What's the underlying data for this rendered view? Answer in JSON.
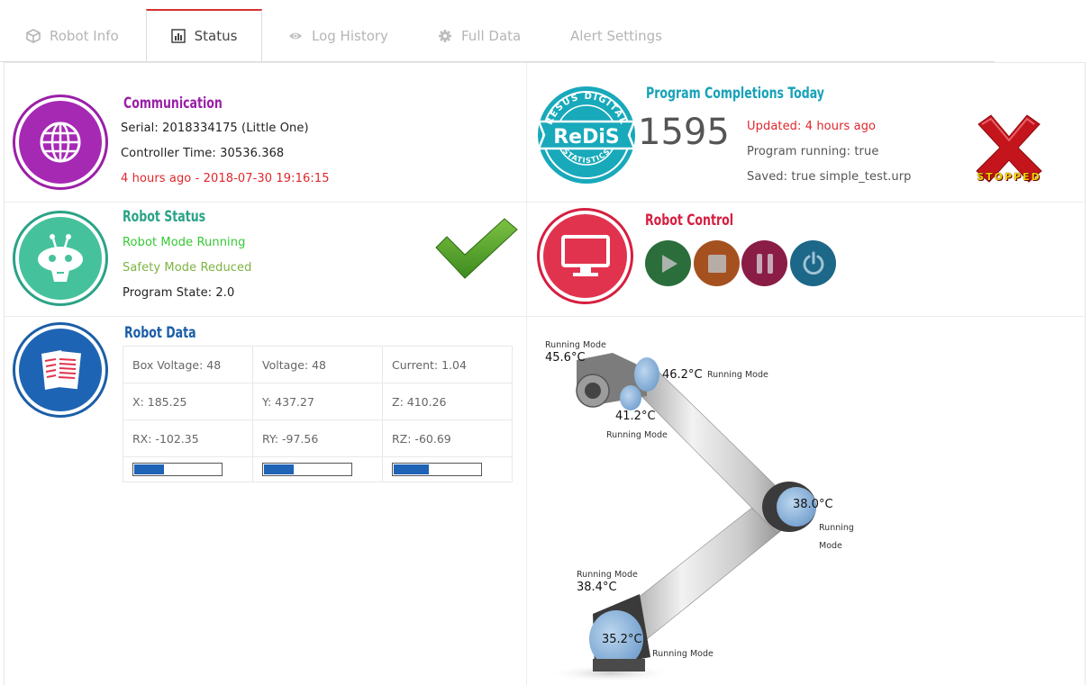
{
  "tabs": [
    {
      "label": "Robot Info",
      "icon": "cube-icon",
      "active": false
    },
    {
      "label": "Status",
      "icon": "bar-chart-icon",
      "active": true
    },
    {
      "label": "Log History",
      "icon": "eye-icon",
      "active": false
    },
    {
      "label": "Full Data",
      "icon": "gear-icon",
      "active": false
    },
    {
      "label": "Alert Settings",
      "icon": "",
      "active": false
    }
  ],
  "communication": {
    "title": "Communication",
    "serial": "Serial: 2018334175 (Little One)",
    "controller_time": "Controller Time: 30536.368",
    "last_seen": "4 hours ago - 2018-07-30 19:16:15"
  },
  "program": {
    "title": "Program Completions Today",
    "logo_top": "RESUS DIGITAL",
    "logo_mid": "ReDiS",
    "logo_bottom": "STATISTICS",
    "count": "1595",
    "updated": "Updated: 4 hours ago",
    "running": "Program running: true",
    "saved": "Saved: true simple_test.urp",
    "stopped_label": "STOPPED"
  },
  "robot_status": {
    "title": "Robot Status",
    "robot_mode": "Robot Mode Running",
    "safety_mode": "Safety Mode Reduced",
    "program_state": "Program State: 2.0"
  },
  "robot_control": {
    "title": "Robot Control",
    "buttons": [
      "play",
      "stop",
      "pause",
      "power"
    ]
  },
  "robot_data": {
    "title": "Robot Data",
    "rows": [
      [
        "Box Voltage: 48",
        "Voltage: 48",
        "Current: 1.04"
      ],
      [
        "X: 185.25",
        "Y: 437.27",
        "Z: 410.26"
      ],
      [
        "RX: -102.35",
        "RY: -97.56",
        "RZ: -60.69"
      ]
    ],
    "bar_levels": [
      0.36,
      0.36,
      0.42
    ]
  },
  "joints": [
    {
      "mode": "Running Mode",
      "temp": "45.6°C"
    },
    {
      "mode": "Running Mode",
      "temp": "46.2°C"
    },
    {
      "mode": "Running Mode",
      "temp": "41.2°C"
    },
    {
      "mode_l1": "Running",
      "mode_l2": "Mode",
      "temp": "38.0°C"
    },
    {
      "mode": "Running Mode",
      "temp": "38.4°C"
    },
    {
      "mode": "Running Mode",
      "temp": "35.2°C"
    }
  ],
  "colors": {
    "communication": "#9b1fa8",
    "program": "#17a2b8",
    "robot_status": "#2aa387",
    "robot_control": "#d61f40",
    "robot_data": "#1b5ea7",
    "alert_red": "#e0262b",
    "ok_green": "#35c935",
    "safety_green": "#7cb342"
  }
}
